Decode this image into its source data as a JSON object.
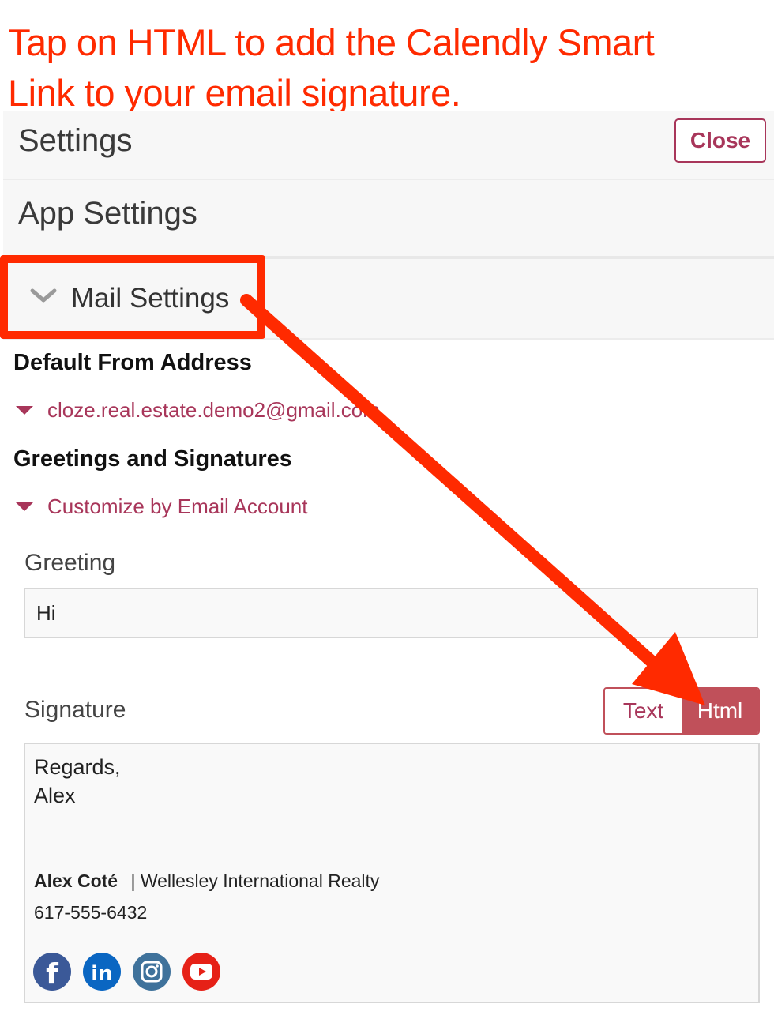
{
  "annotation": {
    "line1": "Tap on HTML to add the Calendly Smart",
    "line2": "Link to your email signature."
  },
  "header": {
    "title": "Settings",
    "close_label": "Close"
  },
  "app_settings": {
    "title": "App Settings"
  },
  "mail_settings": {
    "title": "Mail Settings",
    "icon": "chevron-down-icon"
  },
  "default_from": {
    "heading": "Default From Address",
    "value": "cloze.real.estate.demo2@gmail.com"
  },
  "greetings": {
    "heading": "Greetings and Signatures",
    "customize_label": "Customize by Email Account"
  },
  "greeting": {
    "label": "Greeting",
    "value": "Hi"
  },
  "signature": {
    "label": "Signature",
    "mode_text": "Text",
    "mode_html": "Html",
    "selected_mode": "Html",
    "line1": "Regards,",
    "line2": "Alex",
    "name": "Alex Coté",
    "company": "| Wellesley International Realty",
    "phone": "617-555-6432",
    "social_icons": [
      "facebook-icon",
      "linkedin-icon",
      "instagram-icon",
      "youtube-icon"
    ]
  },
  "colors": {
    "accent": "#a8365a",
    "annotation_red": "#ff2a00",
    "html_toggle_bg": "#c0505a",
    "facebook": "#3b5998",
    "linkedin": "#0a66c2",
    "instagram": "#3f729b",
    "youtube": "#e62117"
  }
}
